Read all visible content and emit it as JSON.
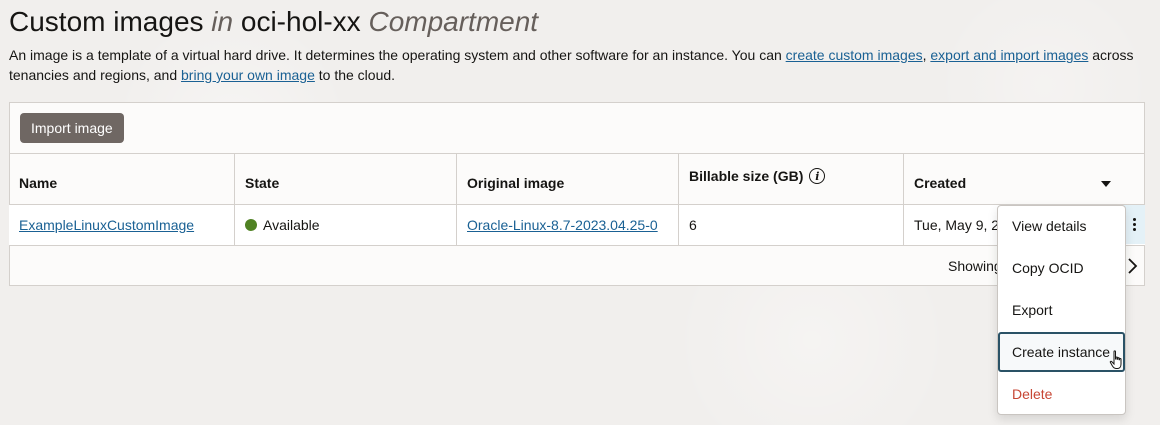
{
  "header": {
    "title_part1": "Custom images ",
    "title_in": "in",
    "title_compartment_name": " oci-hol-xx ",
    "title_compartment_word": "Compartment"
  },
  "description": {
    "text1": "An image is a template of a virtual hard drive. It determines the operating system and other software for an instance. You can ",
    "link1": "create custom images",
    "text2": ", ",
    "link2": "export and import images",
    "text3": " across tenancies and regions, and ",
    "link3": "bring your own image",
    "text4": " to the cloud."
  },
  "toolbar": {
    "import_label": "Import image"
  },
  "table": {
    "columns": {
      "name": "Name",
      "state": "State",
      "original_image": "Original image",
      "billable_size": "Billable size (GB)",
      "created": "Created"
    },
    "rows": [
      {
        "name": "ExampleLinuxCustomImage",
        "state": "Available",
        "original_image": "Oracle-Linux-8.7-2023.04.25-0",
        "billable_size": "6",
        "created": "Tue, May 9, 2"
      }
    ],
    "footer": {
      "showing": "Showing"
    }
  },
  "row_menu": {
    "items": [
      "View details",
      "Copy OCID",
      "Export",
      "Create instance",
      "Delete"
    ]
  },
  "icons": {
    "info": "info-icon",
    "sort": "caret-down-icon",
    "actions": "kebab-icon",
    "next": "chevron-right-icon",
    "cursor": "hand-pointer-icon"
  },
  "colors": {
    "link": "#1a6194",
    "status_available": "#508223",
    "danger": "#c74634",
    "button_bg": "#6f6763"
  }
}
